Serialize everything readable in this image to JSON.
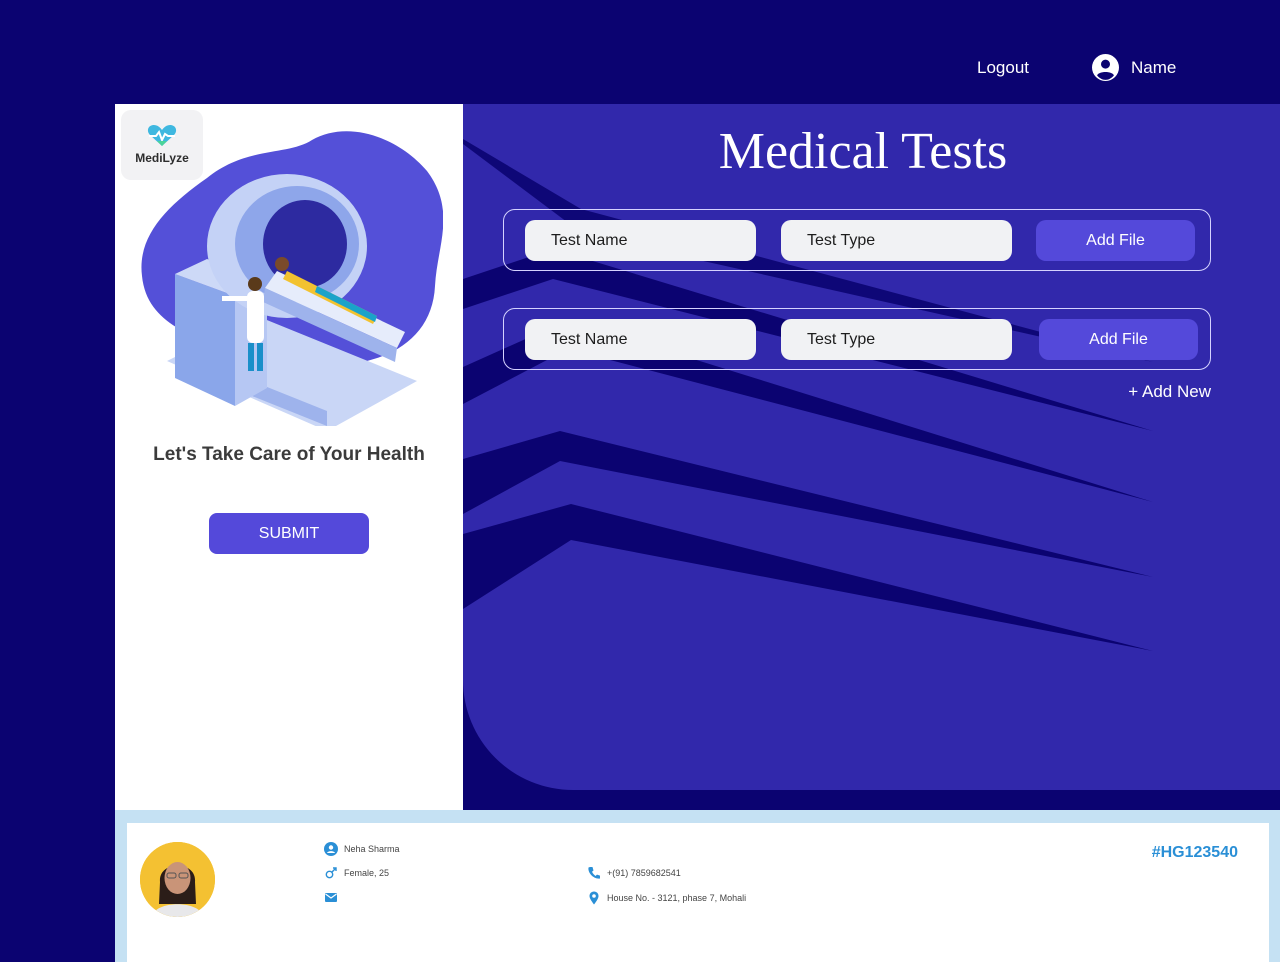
{
  "header": {
    "logout_label": "Logout",
    "user_name": "Name",
    "user_icon": "account-circle-icon"
  },
  "sidebar": {
    "logo_text": "MediLyze",
    "logo_icon": "heart-pulse-icon",
    "tagline": "Let's Take Care of Your Health",
    "submit_label": "SUBMIT"
  },
  "main": {
    "title": "Medical Tests",
    "rows": [
      {
        "name_placeholder": "Test Name",
        "type_placeholder": "Test Type",
        "file_label": "Add File"
      },
      {
        "name_placeholder": "Test Name",
        "type_placeholder": "Test Type",
        "file_label": "Add File"
      }
    ],
    "add_new_label": "+ Add New"
  },
  "patient": {
    "name": "Neha  Sharma",
    "gender_age": "Female, 25",
    "email": "",
    "phone": "+(91) 7859682541",
    "address": "House No. - 3121, phase 7, Mohali",
    "id": "#HG123540"
  },
  "colors": {
    "background": "#0b0371",
    "panel_blue": "#3128ab",
    "button": "#5449da",
    "accent_blue": "#2a8fd6"
  }
}
